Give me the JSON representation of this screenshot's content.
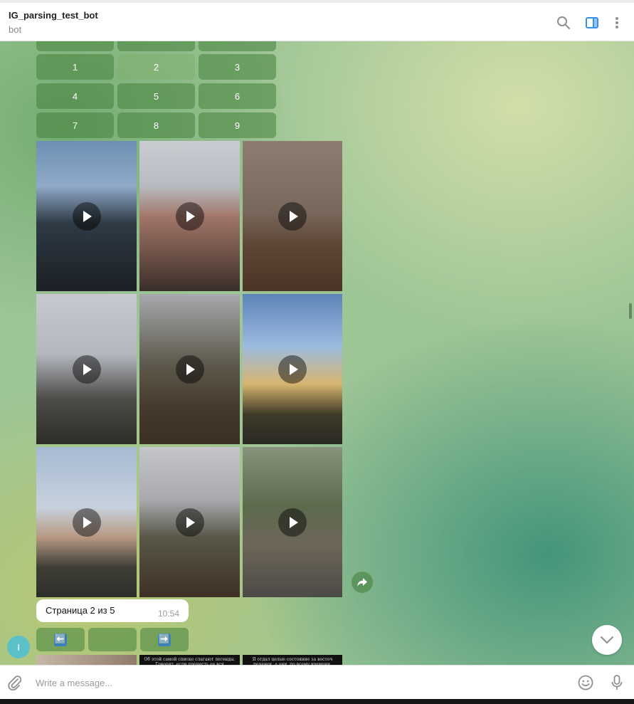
{
  "header": {
    "title": "IG_parsing_test_bot",
    "subtitle": "bot",
    "icons": [
      "search-icon",
      "sidebar-toggle-icon",
      "more-vert-icon"
    ],
    "accent_color": "#3390ec"
  },
  "keyboard": {
    "rows": [
      [
        "1",
        "2",
        "3"
      ],
      [
        "4",
        "5",
        "6"
      ],
      [
        "7",
        "8",
        "9"
      ]
    ]
  },
  "media_grid": {
    "tiles": [
      {
        "kind": "video"
      },
      {
        "kind": "video"
      },
      {
        "kind": "video"
      },
      {
        "kind": "video"
      },
      {
        "kind": "video"
      },
      {
        "kind": "video"
      },
      {
        "kind": "video"
      },
      {
        "kind": "video"
      },
      {
        "kind": "video"
      }
    ]
  },
  "message": {
    "text": "Страница 2 из 5",
    "time": "10:54"
  },
  "pagination": {
    "prev_label": "⬅️",
    "middle_label": "",
    "next_label": "➡️"
  },
  "bottom_tiles": {
    "middle_text": "Об этой самой списке слагают легенды. Говорят, если прочесть ее вся",
    "right_text": "Я отдал целые состояние за восточ печенек, а они, по всему времени, оказались ещё и"
  },
  "avatar": {
    "initial": "I",
    "color": "#5bc0c8"
  },
  "composer": {
    "placeholder": "Write a message..."
  }
}
